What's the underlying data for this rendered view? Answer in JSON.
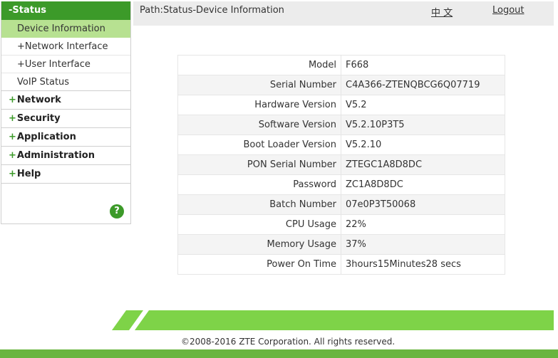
{
  "sidebar": {
    "status_header": "-Status",
    "sub_items": [
      {
        "label": "Device Information",
        "plus": ""
      },
      {
        "label": "Network Interface",
        "plus": "+"
      },
      {
        "label": "User Interface",
        "plus": "+"
      },
      {
        "label": "VoIP Status",
        "plus": ""
      }
    ],
    "top_items": [
      {
        "label": "Network"
      },
      {
        "label": "Security"
      },
      {
        "label": "Application"
      },
      {
        "label": "Administration"
      },
      {
        "label": "Help"
      }
    ],
    "plus_symbol": "+",
    "help_icon": "?"
  },
  "header": {
    "path": "Path:Status-Device Information",
    "language": "中 文",
    "logout": "Logout"
  },
  "device_info": [
    {
      "label": "Model",
      "value": "F668"
    },
    {
      "label": "Serial Number",
      "value": "C4A366-ZTENQBCG6Q07719"
    },
    {
      "label": "Hardware Version",
      "value": "V5.2"
    },
    {
      "label": "Software Version",
      "value": "V5.2.10P3T5"
    },
    {
      "label": "Boot Loader Version",
      "value": "V5.2.10"
    },
    {
      "label": "PON Serial Number",
      "value": "ZTEGC1A8D8DC"
    },
    {
      "label": "Password",
      "value": "ZC1A8D8DC"
    },
    {
      "label": "Batch Number",
      "value": "07e0P3T50068"
    },
    {
      "label": "CPU Usage",
      "value": "22%"
    },
    {
      "label": "Memory Usage",
      "value": "37%"
    },
    {
      "label": "Power On Time",
      "value": "3hours15Minutes28 secs"
    }
  ],
  "footer": {
    "copyright": "©2008-2016 ZTE Corporation. All rights reserved."
  },
  "colors": {
    "accent_green": "#3c9a29",
    "active_green": "#b7e191",
    "band_green": "#7ed348"
  }
}
